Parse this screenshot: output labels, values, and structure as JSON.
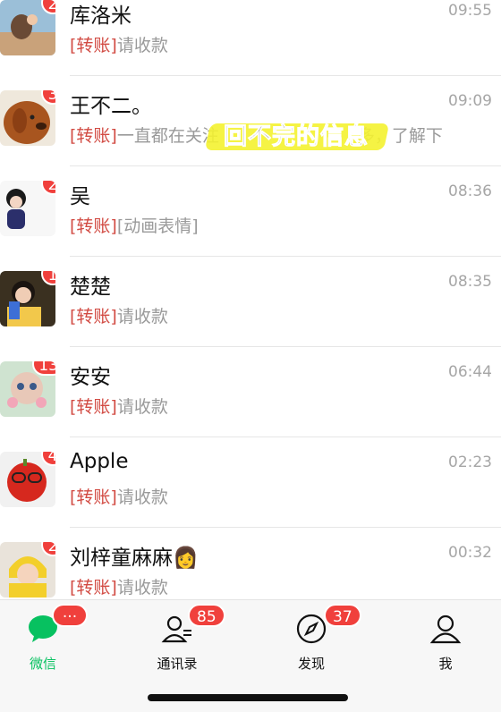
{
  "chats": [
    {
      "name": "库洛米",
      "time": "09:55",
      "badge": "2",
      "tag": "[转账]",
      "preview": "请收款"
    },
    {
      "name": "王不二。",
      "time": "09:09",
      "badge": "3",
      "tag": "[转账]",
      "preview": "一直都在关注",
      "preview_tail": "多，了解下"
    },
    {
      "name": "吴",
      "time": "08:36",
      "badge": "2",
      "tag": "[转账]",
      "preview": "[动画表情]"
    },
    {
      "name": "楚楚",
      "time": "08:35",
      "badge": "1",
      "tag": "[转账]",
      "preview": "请收款"
    },
    {
      "name": "安安",
      "time": "06:44",
      "badge": "13",
      "tag": "[转账]",
      "preview": "请收款"
    },
    {
      "name": "Apple",
      "time": "02:23",
      "badge": "4",
      "tag": "[转账]",
      "preview": "请收款"
    },
    {
      "name": "刘梓童麻麻👩",
      "time": "00:32",
      "badge": "2",
      "tag": "[转账]",
      "preview": "请收款"
    }
  ],
  "overlay_caption": "回不完的信息",
  "tabs": {
    "chats": {
      "label": "微信",
      "badge": "···"
    },
    "contacts": {
      "label": "通讯录",
      "badge": "85"
    },
    "discover": {
      "label": "发现",
      "badge": "37"
    },
    "me": {
      "label": "我"
    }
  },
  "colors": {
    "accent": "#07c160",
    "badge": "#f0403c",
    "transfer_tag": "#d24b43"
  }
}
